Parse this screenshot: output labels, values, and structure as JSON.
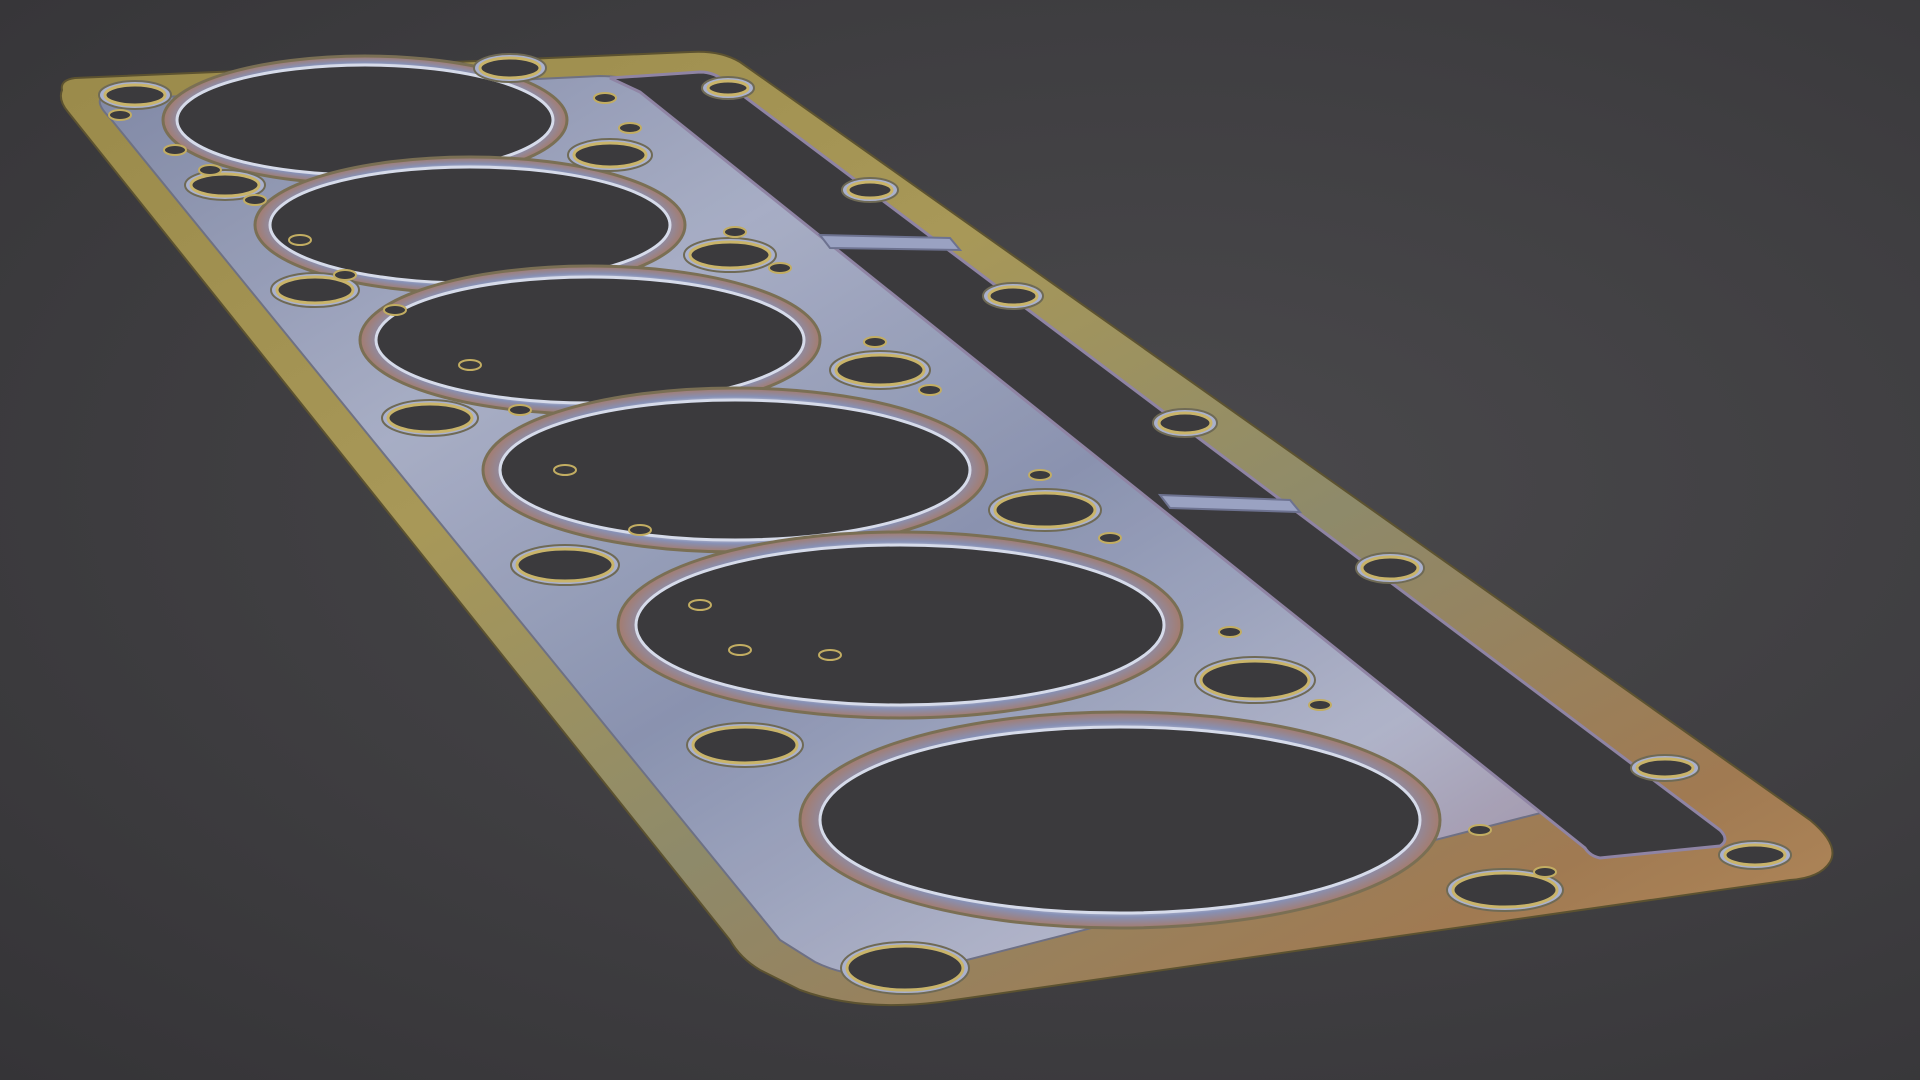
{
  "scene": {
    "subject": "cylinder-head-gasket",
    "cylinder_count": 6,
    "colors": {
      "background": "#3e3d40",
      "brass_edge": "#8c7a3e",
      "brass_light": "#b8a35c",
      "steel_blue": "#8b95b8",
      "steel_highlight": "#c9d0e6",
      "bronze_tint": "#a0684a",
      "hole_fill": "#3b3a3d"
    }
  }
}
